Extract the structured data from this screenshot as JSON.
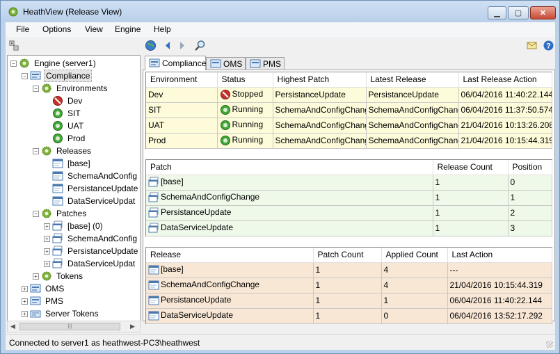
{
  "window": {
    "title": "HeathView (Release View)"
  },
  "menu": [
    "File",
    "Options",
    "View",
    "Engine",
    "Help"
  ],
  "tree": {
    "nodes": [
      {
        "label": "Engine (server1)",
        "icon": "gear-icon",
        "expander": "−"
      },
      {
        "label": "Compliance",
        "icon": "compliance-icon",
        "expander": "−",
        "selected": true
      },
      {
        "label": "Environments",
        "icon": "gear-icon",
        "expander": "−"
      },
      {
        "label": "Dev",
        "icon": "stopped-env-icon",
        "expander": ""
      },
      {
        "label": "SIT",
        "icon": "running-env-icon",
        "expander": ""
      },
      {
        "label": "UAT",
        "icon": "running-env-icon",
        "expander": ""
      },
      {
        "label": "Prod",
        "icon": "running-env-icon",
        "expander": ""
      },
      {
        "label": "Releases",
        "icon": "gear-icon",
        "expander": "−"
      },
      {
        "label": "[base]",
        "icon": "release-icon",
        "expander": ""
      },
      {
        "label": "SchemaAndConfig",
        "icon": "release-icon",
        "expander": ""
      },
      {
        "label": "PersistanceUpdate",
        "icon": "release-icon",
        "expander": ""
      },
      {
        "label": "DataServiceUpdat",
        "icon": "release-icon",
        "expander": ""
      },
      {
        "label": "Patches",
        "icon": "gear-icon",
        "expander": "−"
      },
      {
        "label": "[base] (0)",
        "icon": "patch-icon",
        "expander": "+"
      },
      {
        "label": "SchemaAndConfig",
        "icon": "patch-icon",
        "expander": "+"
      },
      {
        "label": "PersistanceUpdate",
        "icon": "patch-icon",
        "expander": "+"
      },
      {
        "label": "DataServiceUpdat",
        "icon": "patch-icon",
        "expander": "+"
      },
      {
        "label": "Tokens",
        "icon": "gear-icon",
        "expander": "+"
      },
      {
        "label": "OMS",
        "icon": "compliance-icon",
        "expander": "+"
      },
      {
        "label": "PMS",
        "icon": "compliance-icon",
        "expander": "+"
      },
      {
        "label": "Server Tokens",
        "icon": "tokens-icon",
        "expander": "+"
      }
    ]
  },
  "tabs": [
    {
      "label": "Compliance",
      "active": true
    },
    {
      "label": "OMS",
      "active": false
    },
    {
      "label": "PMS",
      "active": false
    }
  ],
  "environments": {
    "headers": [
      "Environment",
      "Status",
      "Highest Patch",
      "Latest Release",
      "Last Release Action"
    ],
    "rows": [
      {
        "env": "Dev",
        "status": "Stopped",
        "status_icon": "stopped-icon",
        "patch": "PersistanceUpdate",
        "release": "PersistanceUpdate",
        "action": "06/04/2016 11:40:22.144"
      },
      {
        "env": "SIT",
        "status": "Running",
        "status_icon": "running-icon",
        "patch": "SchemaAndConfigChange",
        "release": "SchemaAndConfigChange",
        "action": "06/04/2016 11:37:50.574"
      },
      {
        "env": "UAT",
        "status": "Running",
        "status_icon": "running-icon",
        "patch": "SchemaAndConfigChange",
        "release": "SchemaAndConfigChange",
        "action": "21/04/2016 10:13:26.208"
      },
      {
        "env": "Prod",
        "status": "Running",
        "status_icon": "running-icon",
        "patch": "SchemaAndConfigChange",
        "release": "SchemaAndConfigChange",
        "action": "21/04/2016 10:15:44.319"
      }
    ]
  },
  "patches": {
    "headers": [
      "Patch",
      "Release Count",
      "Position"
    ],
    "rows": [
      {
        "patch": "[base]",
        "count": "1",
        "position": "0"
      },
      {
        "patch": "SchemaAndConfigChange",
        "count": "1",
        "position": "1"
      },
      {
        "patch": "PersistanceUpdate",
        "count": "1",
        "position": "2"
      },
      {
        "patch": "DataServiceUpdate",
        "count": "1",
        "position": "3"
      }
    ]
  },
  "releases": {
    "headers": [
      "Release",
      "Patch Count",
      "Applied Count",
      "Last Action"
    ],
    "rows": [
      {
        "release": "[base]",
        "patch_count": "1",
        "applied": "4",
        "action": "---"
      },
      {
        "release": "SchemaAndConfigChange",
        "patch_count": "1",
        "applied": "4",
        "action": "21/04/2016 10:15:44.319"
      },
      {
        "release": "PersistanceUpdate",
        "patch_count": "1",
        "applied": "1",
        "action": "06/04/2016 11:40:22.144"
      },
      {
        "release": "DataServiceUpdate",
        "patch_count": "1",
        "applied": "0",
        "action": "06/04/2016 13:52:17.292"
      }
    ]
  },
  "status": {
    "text": "Connected to server1 as heathwest-PC3\\heathwest"
  },
  "colors": {
    "env_grid": "#fdfbd9",
    "patch_grid": "#eef9ea",
    "release_grid": "#f8e7d5"
  }
}
